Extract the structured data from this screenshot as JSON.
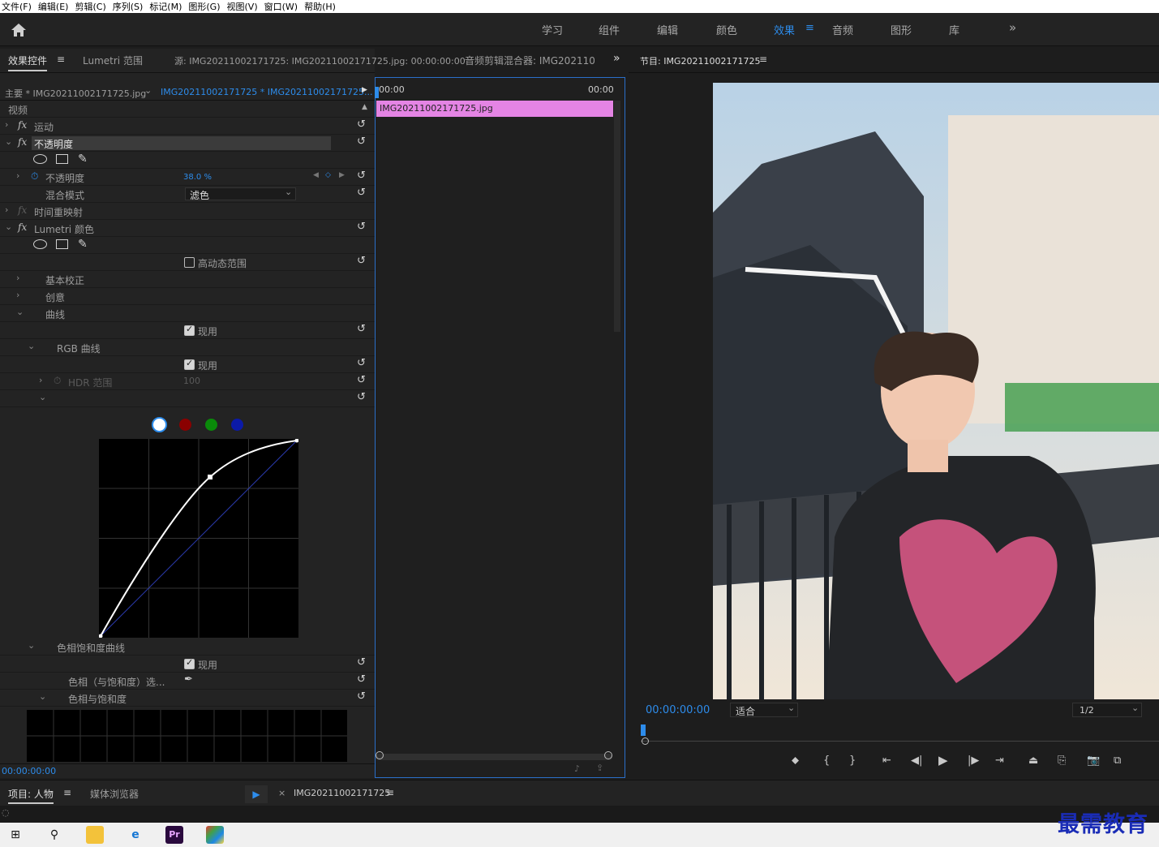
{
  "menu": [
    "文件(F)",
    "编辑(E)",
    "剪辑(C)",
    "序列(S)",
    "标记(M)",
    "图形(G)",
    "视图(V)",
    "窗口(W)",
    "帮助(H)"
  ],
  "workspaces": [
    "学习",
    "组件",
    "编辑",
    "颜色",
    "效果",
    "音频",
    "图形",
    "库"
  ],
  "ws_more": "»",
  "ec": {
    "tab_effects": "效果控件",
    "tab_lumetri": "Lumetri 范围",
    "tab_source": "源: IMG20211002171725: IMG20211002171725.jpg: 00:00:00:00",
    "tab_mixer": "音频剪辑混合器: IMG202110",
    "more": "»",
    "clip_master": "主要 * IMG20211002171725.jpg",
    "clip_seq": "IMG20211002171725 * IMG20211002171725...",
    "tc_start": "00:00",
    "tc_end": "00:00",
    "video": "视频",
    "motion": "运动",
    "opacity_group": "不透明度",
    "opacity": "不透明度",
    "opacity_value": "38.0 %",
    "blend": "混合模式",
    "blend_value": "滤色",
    "time_remap": "时间重映射",
    "lumetri": "Lumetri 颜色",
    "hdr": "高动态范围",
    "basic": "基本校正",
    "creative": "创意",
    "curves": "曲线",
    "enabled": "现用",
    "rgb_curves": "RGB 曲线",
    "hdr_range": "HDR 范围",
    "hdr_range_value": "100",
    "hue_sat_curves": "色相饱和度曲线",
    "hue_sel": "色相（与饱和度）选...",
    "hue_vs_sat": "色相与饱和度",
    "bottom_tc": "00:00:00:00",
    "fx": "fx"
  },
  "clip_name": "IMG20211002171725.jpg",
  "program": {
    "title": "节目: IMG20211002171725",
    "tc": "00:00:00:00",
    "fit": "适合",
    "quality": "1/2"
  },
  "curve_colors": [
    "#ffffff",
    "#8a0000",
    "#0a8a0a",
    "#0b1aa8"
  ],
  "project": {
    "tab": "项目: 人物",
    "media": "媒体浏览器",
    "seq": "IMG20211002171725"
  },
  "watermark": "最需教育"
}
